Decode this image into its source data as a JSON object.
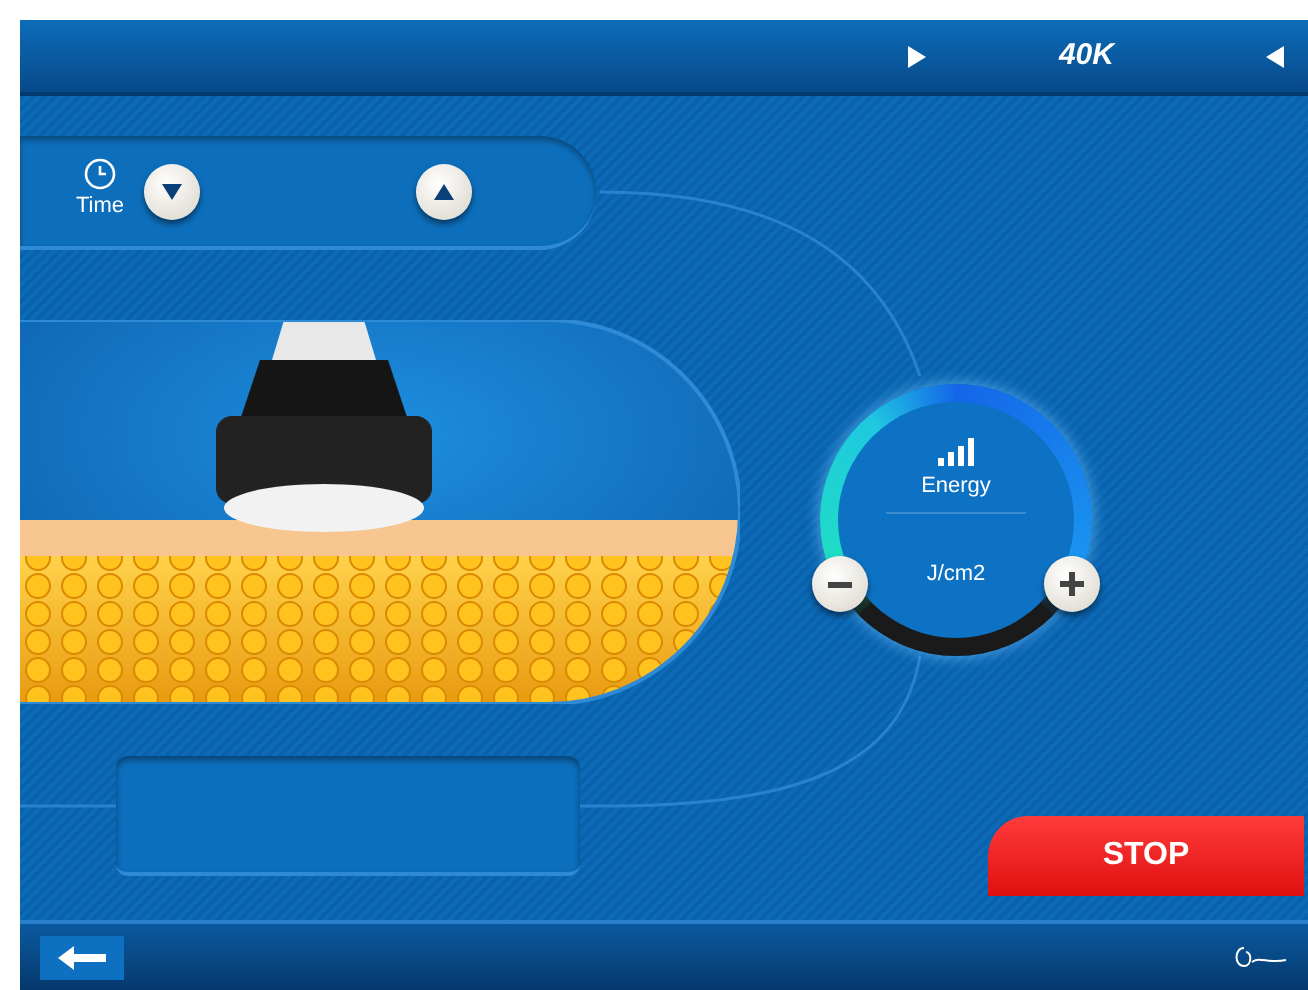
{
  "header": {
    "frequency": "40K"
  },
  "time_panel": {
    "label": "Time"
  },
  "energy_dial": {
    "label": "Energy",
    "unit": "J/cm2"
  },
  "stop_button": {
    "label": "STOP"
  }
}
